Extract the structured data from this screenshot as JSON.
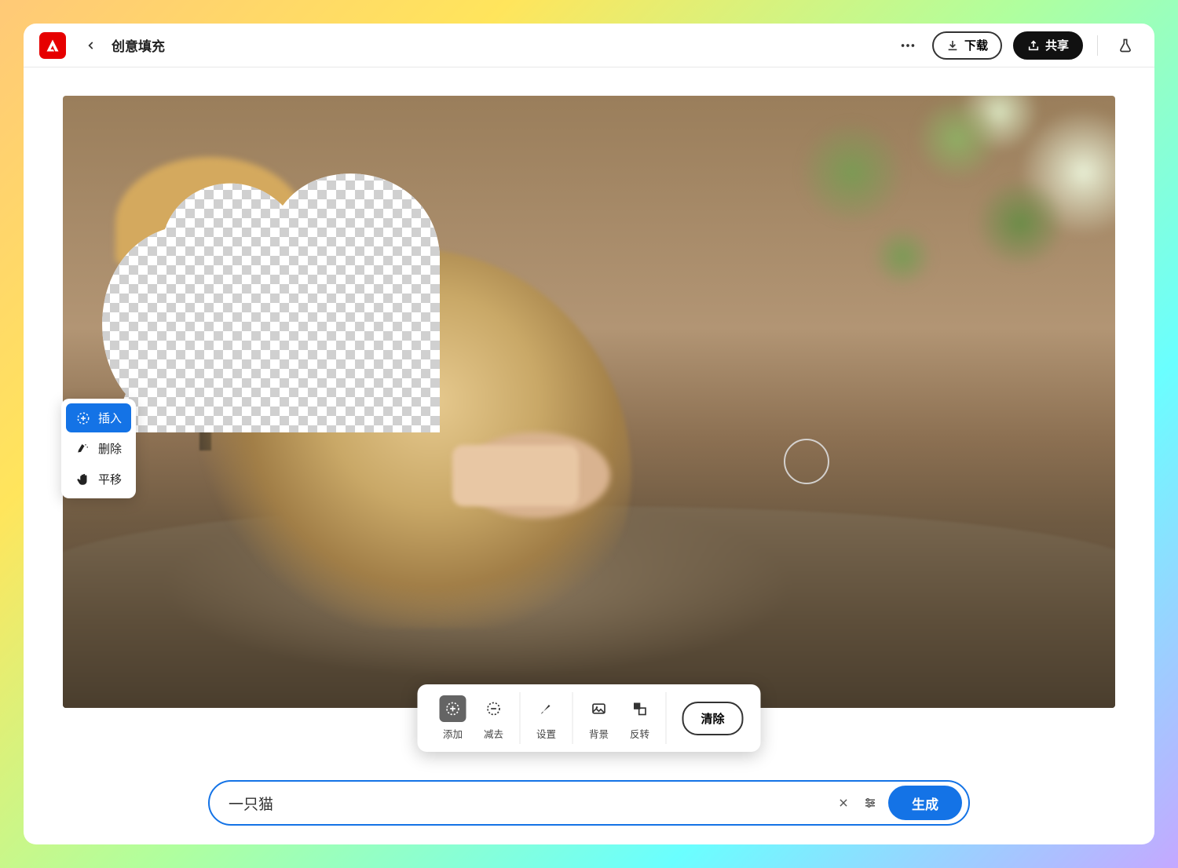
{
  "header": {
    "logo_letter": "A",
    "title": "创意填充",
    "download_label": "下载",
    "share_label": "共享"
  },
  "left_panel": {
    "items": [
      {
        "label": "插入",
        "icon": "insert-icon",
        "active": true
      },
      {
        "label": "删除",
        "icon": "remove-icon",
        "active": false
      },
      {
        "label": "平移",
        "icon": "pan-icon",
        "active": false
      }
    ]
  },
  "toolbar": {
    "add_label": "添加",
    "subtract_label": "减去",
    "settings_label": "设置",
    "background_label": "背景",
    "invert_label": "反转",
    "clear_label": "清除"
  },
  "prompt": {
    "value": "一只猫",
    "generate_label": "生成"
  },
  "colors": {
    "primary": "#1473e6",
    "logo": "#e60000"
  }
}
